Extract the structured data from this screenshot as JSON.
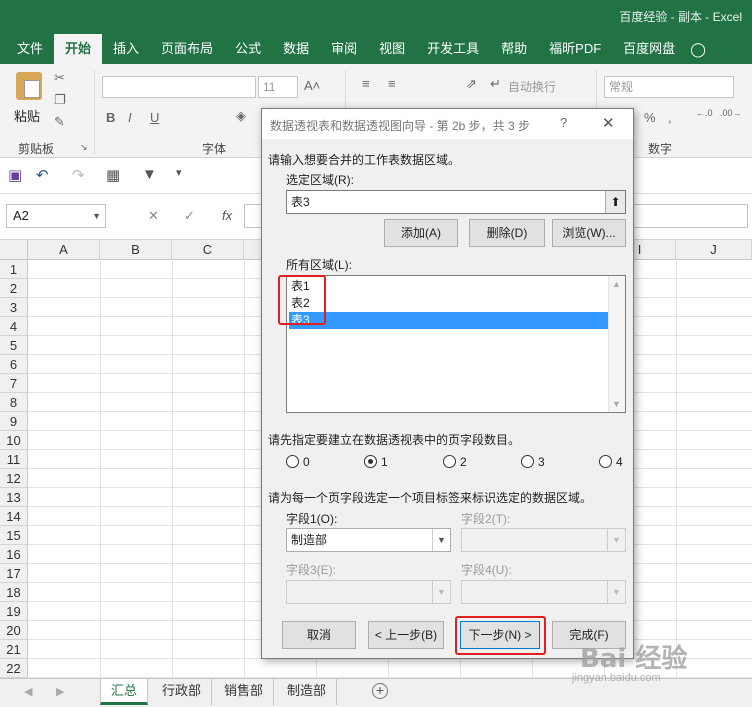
{
  "window": {
    "title": "百度经验 - 副本 - Excel"
  },
  "ribbon_tabs": [
    "文件",
    "开始",
    "插入",
    "页面布局",
    "公式",
    "数据",
    "审阅",
    "视图",
    "开发工具",
    "帮助",
    "福昕PDF",
    "百度网盘"
  ],
  "active_tab": "开始",
  "ribbon": {
    "paste_label": "粘贴",
    "clipboard_label": "剪贴板",
    "font_group_label": "字体",
    "font_size": "11",
    "wrap_text": "自动换行",
    "number_format": "常规",
    "number_group_label": "数字"
  },
  "formula_bar": {
    "name_box": "A2",
    "fx": "fx"
  },
  "grid": {
    "columns": [
      "A",
      "B",
      "C",
      "",
      "",
      "",
      "",
      "",
      "I",
      "J"
    ],
    "rows": [
      "1",
      "2",
      "3",
      "4",
      "5",
      "6",
      "7",
      "8",
      "9",
      "10",
      "11",
      "12",
      "13",
      "14",
      "15",
      "16",
      "17",
      "18",
      "19",
      "20",
      "21",
      "22"
    ]
  },
  "sheet_tabs": [
    "汇总",
    "行政部",
    "销售部",
    "制造部"
  ],
  "active_sheet": "汇总",
  "dialog": {
    "title": "数据透视表和数据透视图向导 - 第 2b 步，共 3 步",
    "help": "?",
    "prompt_range": "请输入想要合并的工作表数据区域。",
    "selected_range_label": "选定区域(R):",
    "selected_range_value": "表3",
    "btn_add": "添加(A)",
    "btn_delete": "删除(D)",
    "btn_browse": "浏览(W)...",
    "all_ranges_label": "所有区域(L):",
    "all_ranges": [
      "表1",
      "表2",
      "表3"
    ],
    "selected_index": 2,
    "page_field_prompt": "请先指定要建立在数据透视表中的页字段数目。",
    "page_field_options": [
      "0",
      "1",
      "2",
      "3",
      "4"
    ],
    "page_field_selected": "1",
    "item_label_prompt": "请为每一个页字段选定一个项目标签来标识选定的数据区域。",
    "field1_label": "字段1(O):",
    "field1_value": "制造部",
    "field2_label": "字段2(T):",
    "field3_label": "字段3(E):",
    "field4_label": "字段4(U):",
    "btn_cancel": "取消",
    "btn_back": "< 上一步(B)",
    "btn_next": "下一步(N) >",
    "btn_finish": "完成(F)"
  },
  "watermark": {
    "text": "Bai 经验",
    "url": "jingyan.baidu.com"
  },
  "colors": {
    "excel_green": "#217346",
    "selection_blue": "#3399ff",
    "highlight_red": "#e02020"
  }
}
